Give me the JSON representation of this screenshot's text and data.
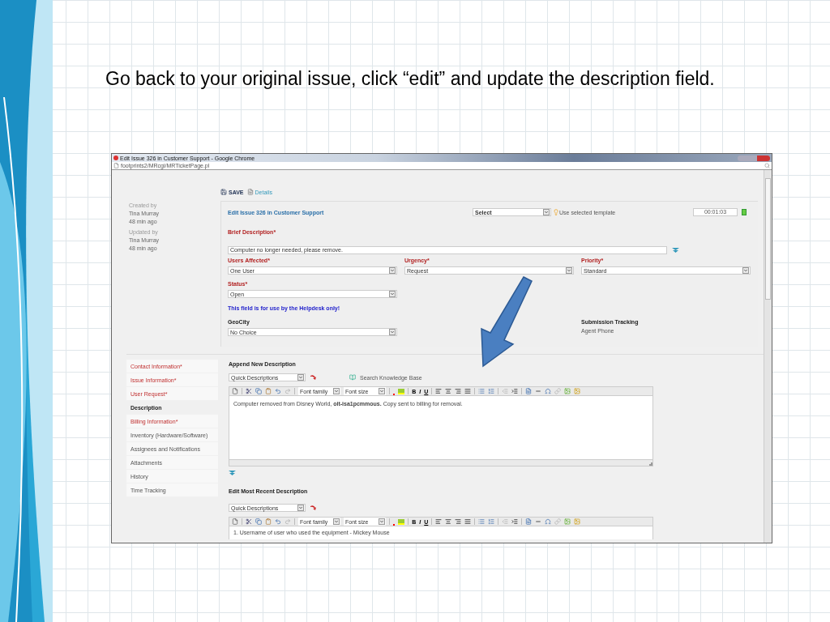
{
  "slide": {
    "title": "Go back to your original issue, click “edit” and update the description field."
  },
  "browser": {
    "title": "Edit Issue 326 in Customer Support - Google Chrome",
    "url": "footprints2/MRcgi/MRTicketPage.pl"
  },
  "toolbar": {
    "save": "SAVE",
    "details": "Details"
  },
  "audit": [
    {
      "label": "Created by",
      "name": "Tina Murray",
      "time": "48 min ago"
    },
    {
      "label": "Updated by",
      "name": "Tina Murray",
      "time": "48 min ago"
    }
  ],
  "form": {
    "heading": "Edit Issue 326 in Customer Support",
    "template_select": "Select",
    "template_label": "Use selected template",
    "timer": "00:01:03",
    "brief": {
      "label": "Brief Description*",
      "value": "Computer no longer needed, please remove."
    },
    "fields": [
      {
        "label": "Users Affected*",
        "value": "One User"
      },
      {
        "label": "Urgency*",
        "value": "Request"
      },
      {
        "label": "Priority*",
        "value": "Standard"
      }
    ],
    "status": {
      "label": "Status*",
      "value": "Open"
    },
    "helpdesk_note": "This field is for use by the Helpdesk only!",
    "geocity": {
      "label": "GeoCity",
      "value": "No Choice"
    },
    "submission": {
      "label": "Submission Tracking",
      "value": "Agent Phone"
    }
  },
  "sections": [
    {
      "label": "Contact Information*",
      "required": true,
      "selected": false
    },
    {
      "label": "Issue Information*",
      "required": true,
      "selected": false
    },
    {
      "label": "User Request*",
      "required": true,
      "selected": false
    },
    {
      "label": "Description",
      "required": false,
      "selected": true
    },
    {
      "label": "Billing Information*",
      "required": true,
      "selected": false
    },
    {
      "label": "Inventory (Hardware/Software)",
      "required": false,
      "selected": false
    },
    {
      "label": "Assignees and Notifications",
      "required": false,
      "selected": false
    },
    {
      "label": "Attachments",
      "required": false,
      "selected": false
    },
    {
      "label": "History",
      "required": false,
      "selected": false
    },
    {
      "label": "Time Tracking",
      "required": false,
      "selected": false
    }
  ],
  "append": {
    "heading": "Append New Description",
    "quick": "Quick Descriptions",
    "kb": "Search Knowledge Base",
    "toolbar": {
      "font_family": "Font family",
      "font_size": "Font size",
      "bold": "B",
      "italic": "I",
      "underline": "U"
    },
    "text": "Computer removed from Disney World, **oit-isa1pcmmous.** Copy sent to billing for removal."
  },
  "edit_recent": {
    "heading": "Edit Most Recent Description",
    "quick": "Quick Descriptions",
    "toolbar": {
      "font_family": "Font family",
      "font_size": "Font size",
      "bold": "B",
      "italic": "I",
      "underline": "U"
    },
    "text": "1. Username of user who used the equipment - Mickey Mouse"
  }
}
